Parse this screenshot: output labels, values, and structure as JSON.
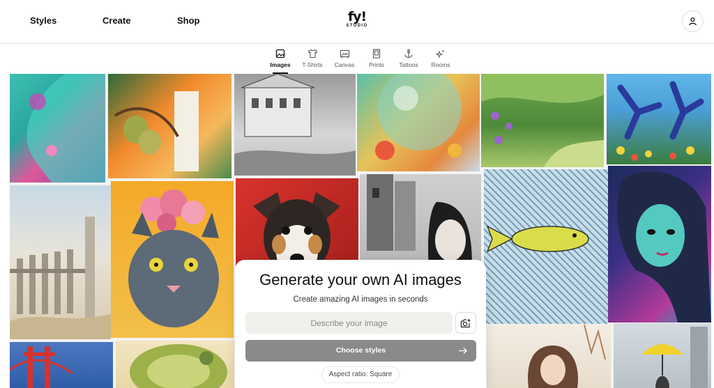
{
  "header": {
    "nav": [
      "Styles",
      "Create",
      "Shop"
    ],
    "logo": {
      "main": "fy!",
      "sub": "STUDIO"
    }
  },
  "tabs": [
    {
      "label": "Images",
      "icon": "image-icon",
      "active": true
    },
    {
      "label": "T-Shirts",
      "icon": "tshirt-icon",
      "active": false
    },
    {
      "label": "Canvas",
      "icon": "canvas-icon",
      "active": false
    },
    {
      "label": "Prints",
      "icon": "print-frame-icon",
      "active": false
    },
    {
      "label": "Tattoos",
      "icon": "anchor-icon",
      "active": false
    },
    {
      "label": "Rooms",
      "icon": "sparkle-icon",
      "active": false
    }
  ],
  "generator": {
    "title": "Generate your own AI images",
    "subtitle": "Create amazing AI images in seconds",
    "prompt_value": "",
    "prompt_placeholder": "Describe your image",
    "choose_styles_label": "Choose styles",
    "aspect_label": "Aspect ratio: Square"
  },
  "colors": {
    "button_bg": "#8a8a8a",
    "input_bg": "#f1f0ed"
  }
}
